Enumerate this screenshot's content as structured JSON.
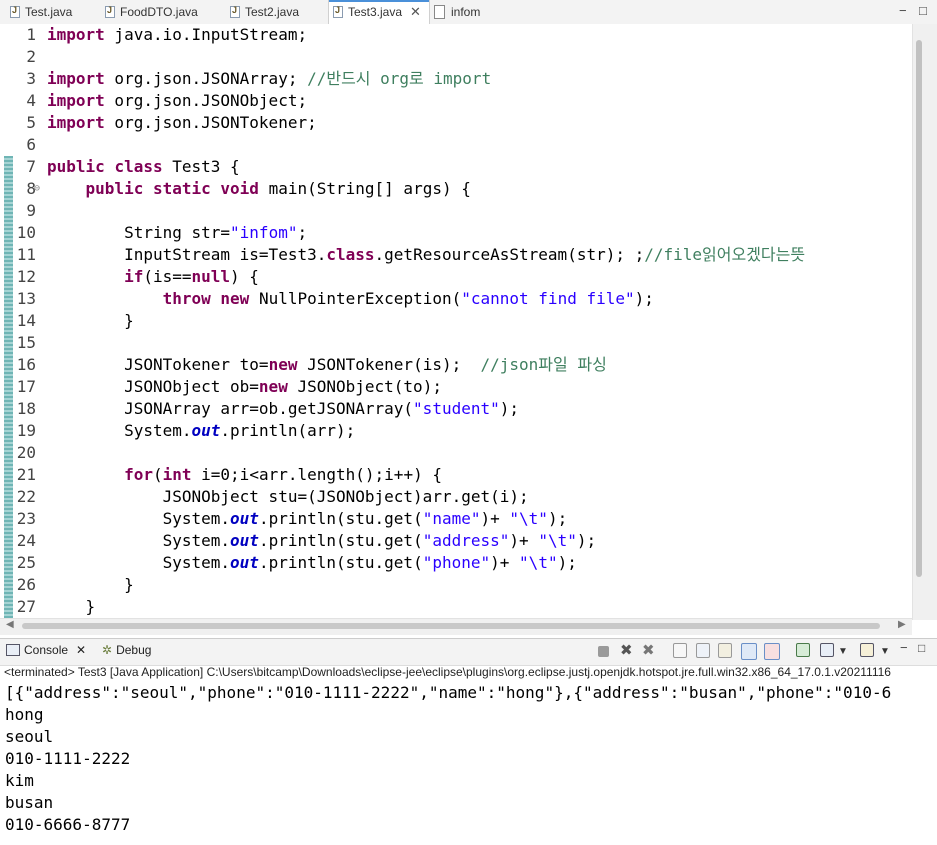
{
  "tabs": [
    {
      "label": "Test.java"
    },
    {
      "label": "FoodDTO.java"
    },
    {
      "label": "Test2.java"
    },
    {
      "label": "Test3.java",
      "active": true
    },
    {
      "label": "infom"
    }
  ],
  "window_controls": {
    "minimize": "−",
    "maximize": "□"
  },
  "editor": {
    "lines": [
      {
        "n": "1",
        "code": "import java.io.InputStream;"
      },
      {
        "n": "2",
        "code": ""
      },
      {
        "n": "3",
        "code": "import org.json.JSONArray; //반드시 org로 import"
      },
      {
        "n": "4",
        "code": "import org.json.JSONObject;"
      },
      {
        "n": "5",
        "code": "import org.json.JSONTokener;"
      },
      {
        "n": "6",
        "code": ""
      },
      {
        "n": "7",
        "code": "public class Test3 {"
      },
      {
        "n": "8",
        "code": "    public static void main(String[] args) {"
      },
      {
        "n": "9",
        "code": ""
      },
      {
        "n": "10",
        "code": "        String str=\"infom\";"
      },
      {
        "n": "11",
        "code": "        InputStream is=Test3.class.getResourceAsStream(str); ;//file읽어오겠다는뜻"
      },
      {
        "n": "12",
        "code": "        if(is==null) {"
      },
      {
        "n": "13",
        "code": "            throw new NullPointerException(\"cannot find file\");"
      },
      {
        "n": "14",
        "code": "        }"
      },
      {
        "n": "15",
        "code": ""
      },
      {
        "n": "16",
        "code": "        JSONTokener to=new JSONTokener(is);  //json파일 파싱"
      },
      {
        "n": "17",
        "code": "        JSONObject ob=new JSONObject(to);"
      },
      {
        "n": "18",
        "code": "        JSONArray arr=ob.getJSONArray(\"student\");"
      },
      {
        "n": "19",
        "code": "        System.out.println(arr);"
      },
      {
        "n": "20",
        "code": ""
      },
      {
        "n": "21",
        "code": "        for(int i=0;i<arr.length();i++) {"
      },
      {
        "n": "22",
        "code": "            JSONObject stu=(JSONObject)arr.get(i);"
      },
      {
        "n": "23",
        "code": "            System.out.println(stu.get(\"name\")+ \"\\t\");"
      },
      {
        "n": "24",
        "code": "            System.out.println(stu.get(\"address\")+ \"\\t\");"
      },
      {
        "n": "25",
        "code": "            System.out.println(stu.get(\"phone\")+ \"\\t\");"
      },
      {
        "n": "26",
        "code": "        }"
      },
      {
        "n": "27",
        "code": "    }"
      }
    ]
  },
  "views": {
    "console_label": "Console",
    "debug_label": "Debug"
  },
  "console": {
    "terminated": "<terminated> Test3 [Java Application] C:\\Users\\bitcamp\\Downloads\\eclipse-jee\\eclipse\\plugins\\org.eclipse.justj.openjdk.hotspot.jre.full.win32.x86_64_17.0.1.v20211116",
    "output": [
      "[{\"address\":\"seoul\",\"phone\":\"010-1111-2222\",\"name\":\"hong\"},{\"address\":\"busan\",\"phone\":\"010-6",
      "hong",
      "seoul",
      "010-1111-2222",
      "kim",
      "busan",
      "010-6666-8777"
    ]
  },
  "colors": {
    "keyword": "#7f0055",
    "string": "#2a00ff",
    "comment": "#3f7f5f",
    "field": "#0000c0"
  }
}
